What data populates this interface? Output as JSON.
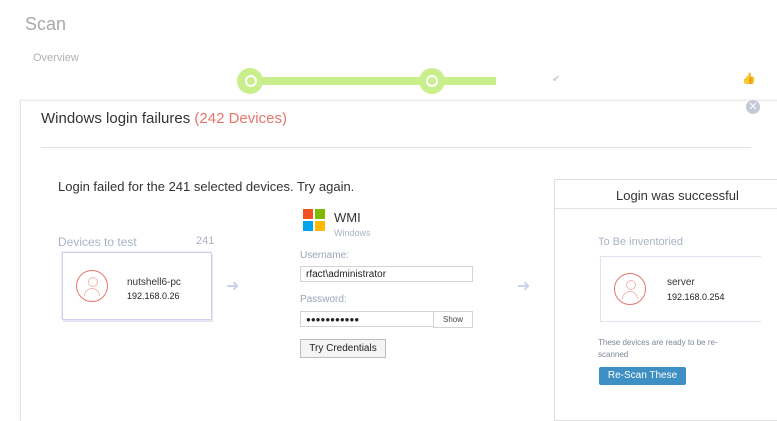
{
  "page": {
    "title": "Scan",
    "tab": "Overview"
  },
  "progress": {
    "steps": [
      "search-icon",
      "circle-icon",
      "check-icon",
      "thumbs-up-icon"
    ],
    "active_color": "#c8ef8c"
  },
  "modal": {
    "title": "Windows login failures",
    "count_label": "(242 Devices)",
    "count_color": "#e8766c",
    "fail_message": "Login failed for the 241 selected devices. Try again.",
    "devices_label": "Devices to test",
    "devices_count": "241",
    "device": {
      "name": "nutshell6-pc",
      "ip": "192.168.0.26"
    },
    "wmi": {
      "title": "WMI",
      "subtitle": "Windows",
      "username_label": "Username:",
      "username_value": "rfact\\administrator",
      "password_label": "Password:",
      "password_value": "●●●●●●●●●●●",
      "show_label": "Show",
      "try_label": "Try Credentials"
    },
    "success": {
      "title": "Login was successful",
      "list_label": "To Be inventoried",
      "device": {
        "name": "server",
        "ip": "192.168.0.254"
      },
      "ready_message": "These devices are ready to be re-scanned",
      "rescan_label": "Re-Scan These"
    }
  }
}
